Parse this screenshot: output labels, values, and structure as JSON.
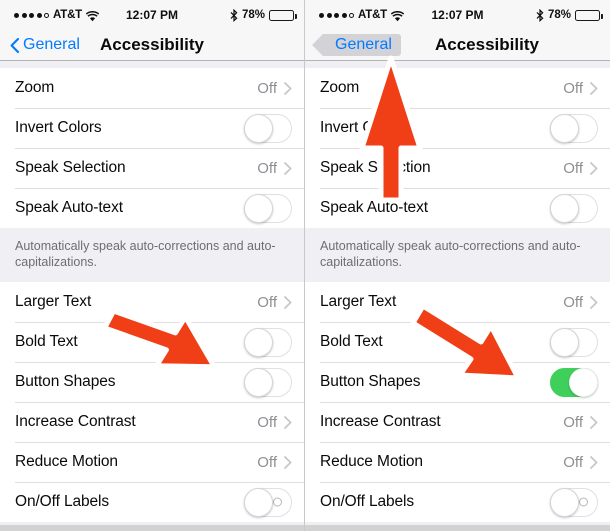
{
  "status_bar": {
    "signal_dots_filled": 4,
    "signal_dots_total": 5,
    "carrier": "AT&T",
    "wifi_icon": "wifi-icon",
    "time": "12:07 PM",
    "bluetooth_icon": "bluetooth-icon",
    "battery_percent": "78%",
    "battery_level": 78
  },
  "nav": {
    "back_label": "General",
    "title": "Accessibility",
    "back_icon": "chevron-left-icon",
    "accent_color": "#047aff"
  },
  "footnote": "Automatically speak auto-corrections and auto-capitalizations.",
  "values": {
    "off": "Off"
  },
  "rows_top": [
    {
      "label": "Zoom",
      "type": "disclosure",
      "value": "Off"
    },
    {
      "label": "Invert Colors",
      "type": "toggle",
      "state": "off"
    },
    {
      "label": "Speak Selection",
      "type": "disclosure",
      "value": "Off"
    },
    {
      "label": "Speak Auto-text",
      "type": "toggle",
      "state": "off"
    }
  ],
  "rows_bottom_left": [
    {
      "label": "Larger Text",
      "type": "disclosure",
      "value": "Off"
    },
    {
      "label": "Bold Text",
      "type": "toggle",
      "state": "off"
    },
    {
      "label": "Button Shapes",
      "type": "toggle",
      "state": "off"
    },
    {
      "label": "Increase Contrast",
      "type": "disclosure",
      "value": "Off"
    },
    {
      "label": "Reduce Motion",
      "type": "disclosure",
      "value": "Off"
    },
    {
      "label": "On/Off Labels",
      "type": "toggle",
      "state": "off",
      "labels_glyph": true
    }
  ],
  "rows_bottom_right": [
    {
      "label": "Larger Text",
      "type": "disclosure",
      "value": "Off"
    },
    {
      "label": "Bold Text",
      "type": "toggle",
      "state": "off"
    },
    {
      "label": "Button Shapes",
      "type": "toggle",
      "state": "on"
    },
    {
      "label": "Increase Contrast",
      "type": "disclosure",
      "value": "Off"
    },
    {
      "label": "Reduce Motion",
      "type": "disclosure",
      "value": "Off"
    },
    {
      "label": "On/Off Labels",
      "type": "toggle",
      "state": "off",
      "labels_glyph": true
    }
  ],
  "annotations": {
    "color": "#f03e16",
    "left_arrow": "arrow pointing down-right to Button Shapes toggle",
    "right_arrow_up": "arrow pointing up to General back button",
    "right_arrow_down": "arrow pointing down-right to Button Shapes toggle"
  },
  "panels": {
    "left": {
      "name": "button-shapes-off",
      "back_button_shaped": false
    },
    "right": {
      "name": "button-shapes-on",
      "back_button_shaped": true
    }
  },
  "toggle_colors": {
    "on": "#3ed05a",
    "off": "#ffffff"
  }
}
